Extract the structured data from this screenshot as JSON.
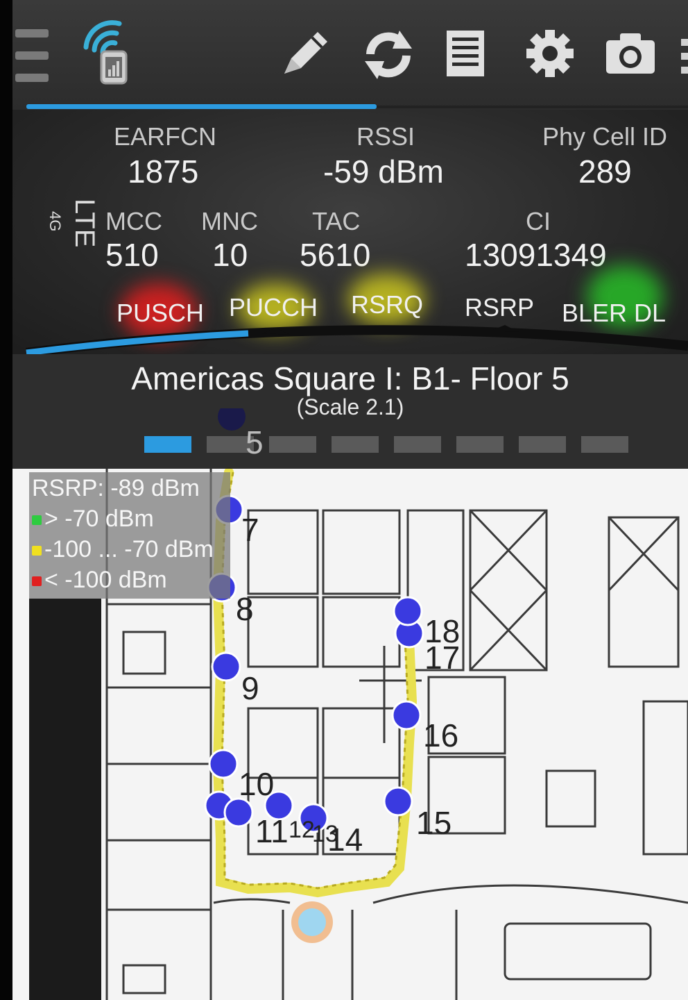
{
  "toolbar": {
    "icons": [
      "menu-icon",
      "lte-signal-app-icon",
      "pencil-icon",
      "refresh-icon",
      "list-icon",
      "gear-icon",
      "camera-icon",
      "overflow-menu-icon"
    ]
  },
  "cell": {
    "earfcn_label": "EARFCN",
    "earfcn": "1875",
    "rssi_label": "RSSI",
    "rssi": "-59 dBm",
    "pci_label": "Phy Cell ID",
    "pci": "289",
    "tech_small": "4G",
    "tech": "LTE",
    "mcc_label": "MCC",
    "mcc": "510",
    "mnc_label": "MNC",
    "mnc": "10",
    "tac_label": "TAC",
    "tac": "5610",
    "ci_label": "CI",
    "ci": "13091349"
  },
  "indicators": [
    {
      "label": "PUSCH",
      "color": "#e02020"
    },
    {
      "label": "PUCCH",
      "color": "#e6e020"
    },
    {
      "label": "RSRQ",
      "color": "#e6e020"
    },
    {
      "label": "RSRP",
      "color": "#ffffff"
    },
    {
      "label": "BLER DL",
      "color": "#30c030"
    }
  ],
  "floor": {
    "title": "Americas Square I: B1- Floor 5",
    "scale": "(Scale 2.1)",
    "floor_tabs": 8
  },
  "legend": {
    "title": "RSRP: -89 dBm",
    "good": "> -70 dBm",
    "mid": "-100 ... -70 dBm",
    "bad": "< -100 dBm",
    "good_color": "#2ecc40",
    "mid_color": "#f0e020",
    "bad_color": "#e02020"
  },
  "measurement_points": [
    "5",
    "7",
    "8",
    "9",
    "10",
    "11",
    "12",
    "13",
    "14",
    "15",
    "16",
    "17",
    "18"
  ]
}
